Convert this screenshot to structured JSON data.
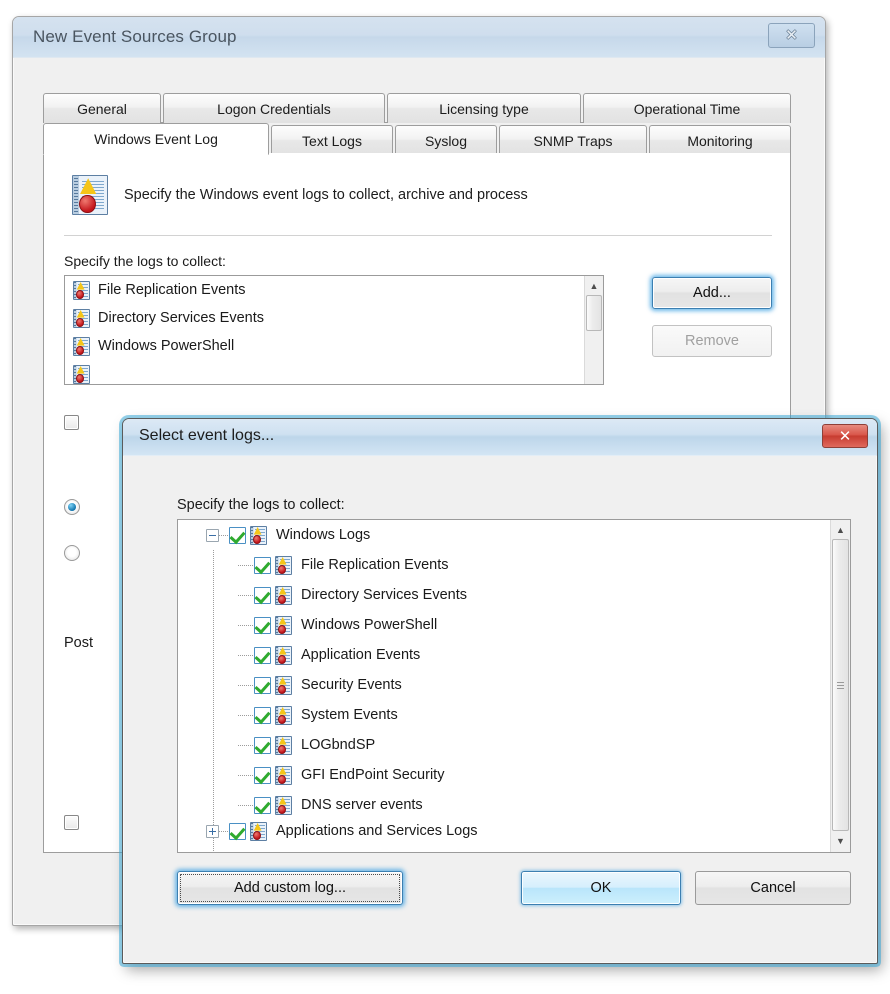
{
  "background_window": {
    "title": "New Event Sources Group",
    "close_label": "✕",
    "tabs_row1": [
      {
        "label": "General"
      },
      {
        "label": "Logon Credentials"
      },
      {
        "label": "Licensing type"
      },
      {
        "label": "Operational Time"
      }
    ],
    "tabs_row2": [
      {
        "label": "Windows Event Log",
        "selected": true
      },
      {
        "label": "Text Logs"
      },
      {
        "label": "Syslog"
      },
      {
        "label": "SNMP Traps"
      },
      {
        "label": "Monitoring"
      }
    ],
    "header_text": "Specify the Windows event logs to collect, archive and process",
    "list_label": "Specify the logs to collect:",
    "list_items": [
      "File Replication Events",
      "Directory Services Events",
      "Windows PowerShell"
    ],
    "add_button": "Add...",
    "remove_button": "Remove",
    "post_label": "Post"
  },
  "modal": {
    "title": "Select event logs...",
    "close_label": "✕",
    "list_label": "Specify the logs to collect:",
    "tree": [
      {
        "label": "Windows Logs",
        "depth": 0,
        "checked": true,
        "expander": "minus"
      },
      {
        "label": "File Replication Events",
        "depth": 1,
        "checked": true,
        "expander": "none"
      },
      {
        "label": "Directory Services Events",
        "depth": 1,
        "checked": true,
        "expander": "none"
      },
      {
        "label": "Windows PowerShell",
        "depth": 1,
        "checked": true,
        "expander": "none"
      },
      {
        "label": "Application Events",
        "depth": 1,
        "checked": true,
        "expander": "none"
      },
      {
        "label": "Security Events",
        "depth": 1,
        "checked": true,
        "expander": "none"
      },
      {
        "label": "System Events",
        "depth": 1,
        "checked": true,
        "expander": "none"
      },
      {
        "label": "LOGbndSP",
        "depth": 1,
        "checked": true,
        "expander": "none"
      },
      {
        "label": "GFI EndPoint Security",
        "depth": 1,
        "checked": true,
        "expander": "none"
      },
      {
        "label": "DNS server events",
        "depth": 1,
        "checked": true,
        "expander": "none"
      },
      {
        "label": "Applications and Services Logs",
        "depth": 0,
        "checked": true,
        "expander": "plus"
      }
    ],
    "add_custom_button": "Add custom log...",
    "ok_button": "OK",
    "cancel_button": "Cancel",
    "scroll_up_arrow": "▲",
    "scroll_down_arrow": "▼"
  },
  "colors": {
    "accent_focus": "#3ca0e1",
    "default_button": "#b9e5fb",
    "close_active": "#c73c30",
    "check_green": "#2faa2f",
    "window_face": "#f0f0f0"
  }
}
